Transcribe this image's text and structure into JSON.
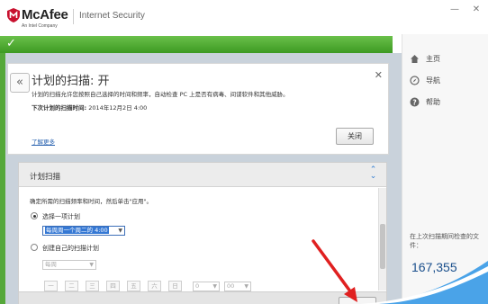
{
  "window": {
    "brand": "McAfee",
    "brand_tagline": "An Intel Company",
    "app_title": "Internet Security",
    "minimize_glyph": "—",
    "close_glyph": "✕"
  },
  "status": {
    "icon": "check-icon",
    "accent_color": "#4caf32"
  },
  "sidebar": {
    "items": [
      {
        "label": "主页",
        "icon": "home-icon"
      },
      {
        "label": "导航",
        "icon": "compass-icon"
      },
      {
        "label": "帮助",
        "icon": "help-icon"
      }
    ],
    "last_scan_label": "在上次扫描期间检查的文件：",
    "last_scan_value": "167,355"
  },
  "scan_panel": {
    "back_glyph": "«",
    "title": "计划的扫描: 开",
    "description": "计划的扫描允许您按照自己选择的时间和频率，自动检查 PC 上是否有病毒、间谍软件和其他威胁。",
    "next_scan_label": "下次计划的扫描时间:",
    "next_scan_value": "2014年12月2日 4:00",
    "learn_more": "了解更多",
    "close_button": "关闭"
  },
  "schedule": {
    "title": "计划扫描",
    "instruction": "确定所需的扫描频率和时间，然后单击\"应用\"。",
    "option_preset": "选择一项计划",
    "preset_value": "每周周一个周二的 4:00",
    "option_custom": "创建自己的扫描计划",
    "frequency_value": "每周",
    "days": [
      "一",
      "二",
      "三",
      "四",
      "五",
      "六",
      "日"
    ],
    "hour_value": "0",
    "minute_value": "00"
  }
}
